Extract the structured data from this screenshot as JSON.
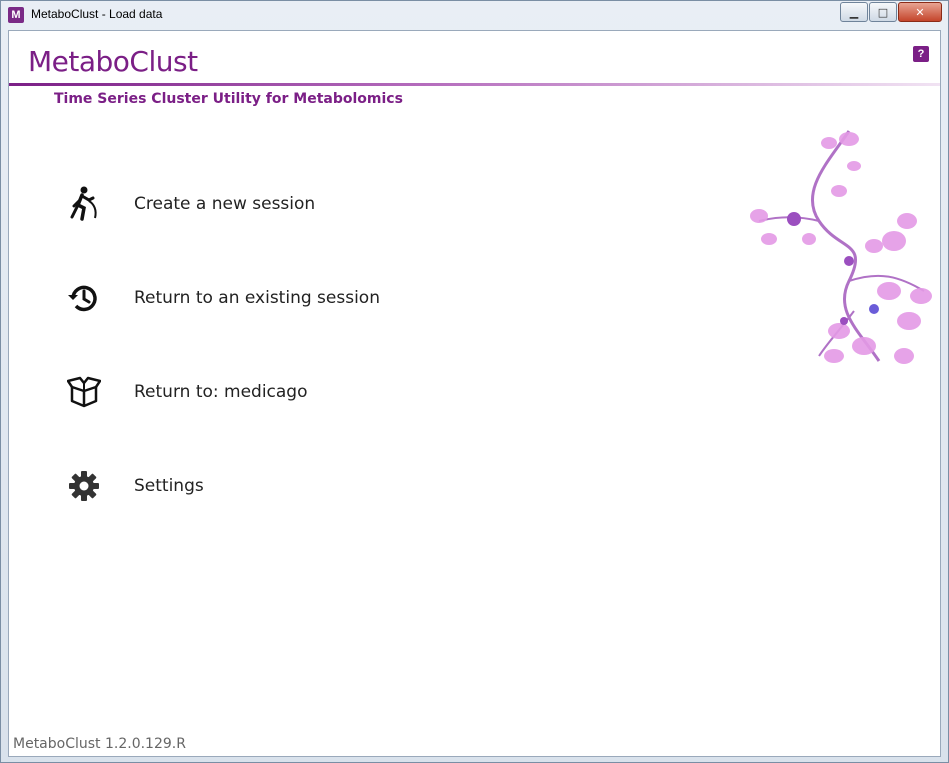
{
  "window": {
    "title": "MetaboClust - Load data",
    "app_icon_letter": "M",
    "minimize_glyph": "▁",
    "maximize_glyph": "□",
    "close_glyph": "✕"
  },
  "header": {
    "app_title": "MetaboClust",
    "subtitle": "Time Series Cluster Utility for Metabolomics",
    "help_glyph": "?"
  },
  "menu": [
    {
      "label": "Create a new session",
      "icon": "hiker-icon"
    },
    {
      "label": "Return to an existing session",
      "icon": "history-icon"
    },
    {
      "label": "Return to: medicago",
      "icon": "box-icon"
    },
    {
      "label": "Settings",
      "icon": "gear-icon"
    }
  ],
  "footer": {
    "version": "MetaboClust 1.2.0.129.R"
  },
  "colors": {
    "accent": "#7b1f86",
    "flower_pink": "#e49ae6",
    "flower_purple": "#9b4fbf"
  }
}
